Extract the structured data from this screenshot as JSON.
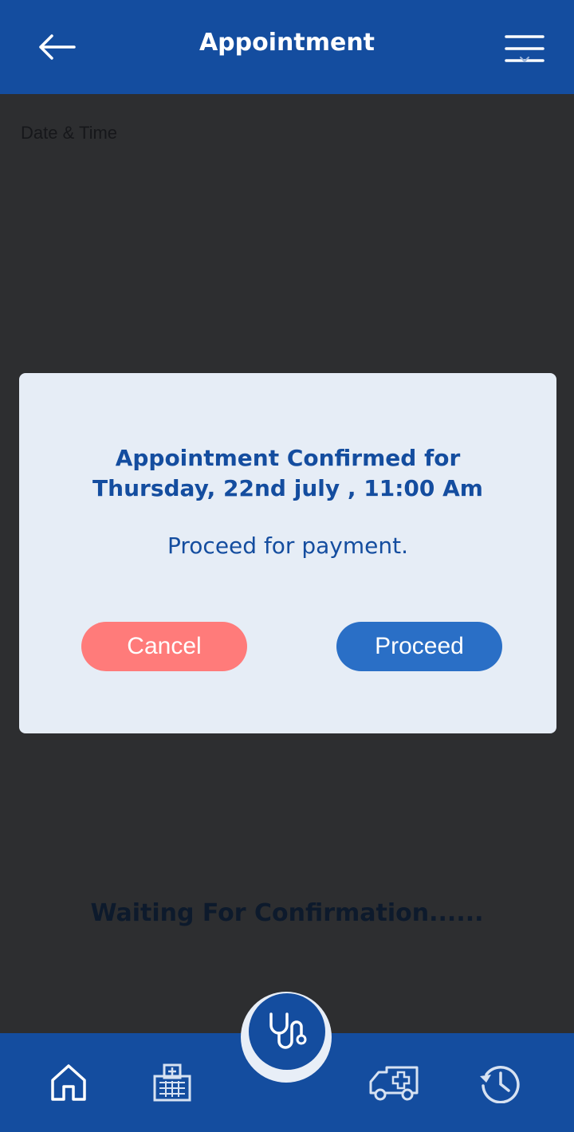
{
  "header": {
    "title": "Appointment",
    "back_icon": "arrow-left-icon",
    "menu_icon": "hamburger-menu-icon"
  },
  "content": {
    "date_time_label": "Date & Time",
    "waiting_text": "Waiting For Confirmation......"
  },
  "dialog": {
    "heading_line1": "Appointment Confirmed for",
    "heading_line2": "Thursday, 22nd july , 11:00 Am",
    "subtext": "Proceed for payment.",
    "cancel_label": "Cancel",
    "proceed_label": "Proceed"
  },
  "bottom_nav": {
    "items": [
      "home-icon",
      "hospital-icon",
      "stethoscope-icon",
      "ambulance-icon",
      "history-icon"
    ]
  },
  "colors": {
    "primary": "#144d9f",
    "overlay": "#2d2e30",
    "dialog_bg": "#e6edf6",
    "cancel": "#ff7b7a",
    "proceed": "#2a6fc6"
  }
}
